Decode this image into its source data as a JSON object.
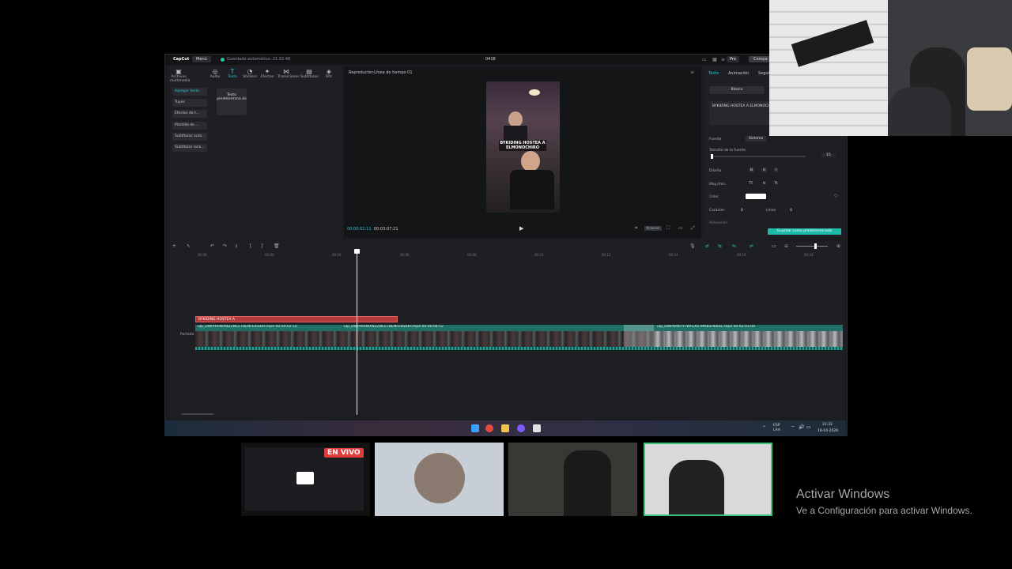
{
  "app": {
    "logo": "CapCut",
    "menu_label": "Menú",
    "autosave": "Guardado automático: 21:32:48",
    "project_title": "0418",
    "pro_label": "Pro",
    "compartir_label": "Compa"
  },
  "left_panel": {
    "tabs": [
      {
        "label": "Archivos multimedia",
        "icon": "media-icon"
      },
      {
        "label": "Audio",
        "icon": "audio-icon"
      },
      {
        "label": "Texto",
        "icon": "text-icon"
      },
      {
        "label": "Stickers",
        "icon": "sticker-icon"
      },
      {
        "label": "Efectos",
        "icon": "effects-icon"
      },
      {
        "label": "Transiciones",
        "icon": "transition-icon"
      },
      {
        "label": "Subtítulos",
        "icon": "subtitles-icon"
      },
      {
        "label": "Filtr",
        "icon": "filter-icon"
      }
    ],
    "side_buttons": [
      "Agregar texto",
      "Tuyos",
      "Efectos de t...",
      "Plantilla de ...",
      "Subtítulos auto...",
      "Subtítulos loca..."
    ],
    "card_label": "Texto predetermina do"
  },
  "player": {
    "title": "Reproductor-Línea de tiempo 01",
    "caption": "BYKIDING HOSTEA A ELMONOCHIRO",
    "current_time": "00:00:02:11",
    "total_time": "00:03:07:21",
    "ratio_label": "Relación"
  },
  "right_panel": {
    "tabs": [
      "Texto",
      "Animación",
      "Seguir"
    ],
    "segment": "Básico",
    "text_value": "BYKIDING HOSTEA A ELMONOCHIRO",
    "font_label": "Fuente",
    "font_value": "Sistema",
    "size_label": "Tamaño de la fuente",
    "size_value": "15",
    "design_label": "Diseño",
    "design_opts": [
      "B",
      "U",
      "I"
    ],
    "case_label": "May./min.",
    "case_opts": [
      "TT",
      "tt",
      "Tt"
    ],
    "color_label": "Color",
    "spacing_label": "Carácter",
    "spacing_value": "0",
    "line_label": "Línea",
    "line_value": "0",
    "align_label": "Alineación",
    "save_default": "Guardar como predeterminado"
  },
  "timeline": {
    "ruler": [
      "00:00",
      "00:02",
      "00:04",
      "00:06",
      "00:08",
      "00:10",
      "00:12",
      "00:14",
      "00:16",
      "00:18"
    ],
    "text_clip": "BYKIDING HOSTEA A",
    "clip_labels": [
      "ulp_DWPHRIWXNZZNCE7BENFE4SIDH.mp4  00:00:02:10",
      "ulp_DWPHRIWXNZZNCE7BENFE4SIDH.mp4  00:00:04:12",
      "ulp_DWPHRKTYTWFEXSTMR8SH66SC.mp4  00:02:01:04"
    ],
    "cover_label": "Portada"
  },
  "taskbar": {
    "lang": "ESP",
    "lang2": "LAA",
    "time": "21:32",
    "date": "18-04-2026"
  },
  "stream": {
    "live_badge": "EN VIVO"
  },
  "watermark": {
    "line1": "Activar Windows",
    "line2": "Ve a Configuración para activar Windows."
  }
}
